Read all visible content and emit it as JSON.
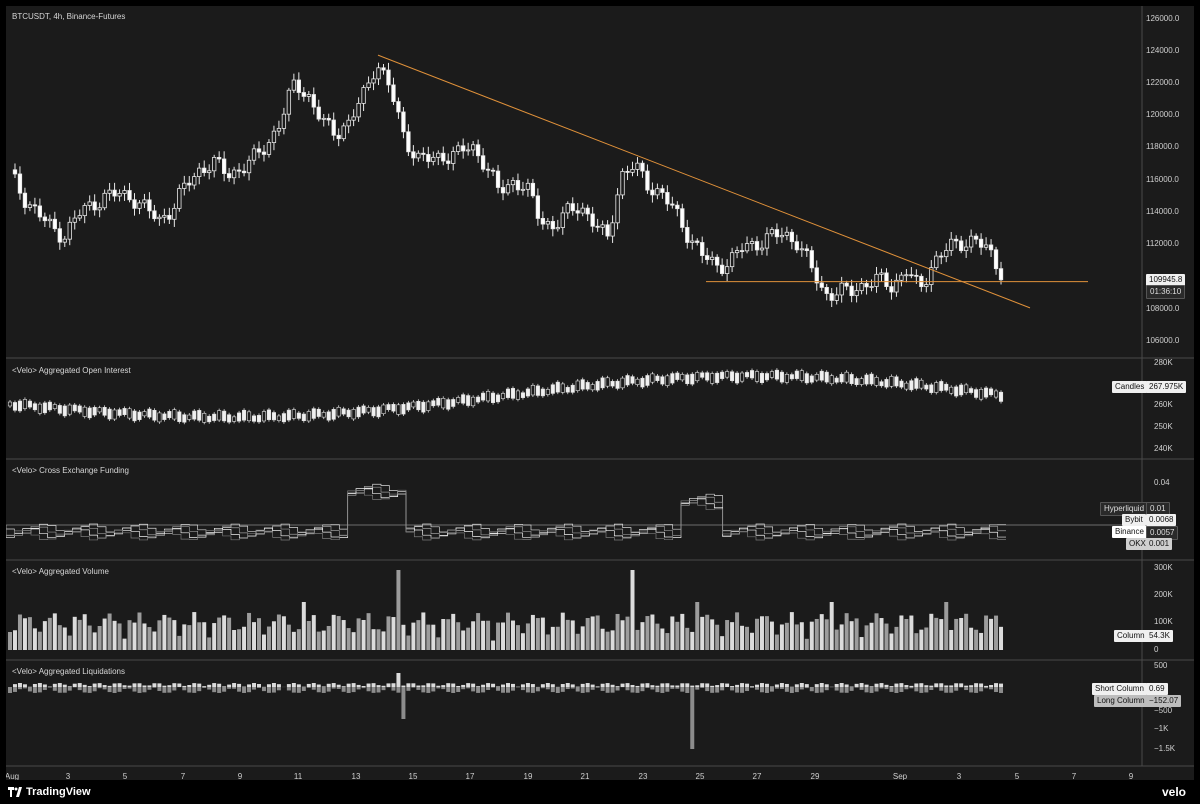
{
  "symbol_title": "BTCUSDT, 4h, Binance-Futures",
  "panes": {
    "open_interest": {
      "title": "<Velo> Aggregated Open Interest",
      "axis": [
        "280K",
        "260K",
        "250K",
        "240K"
      ],
      "tag_label": "Candles",
      "tag_value": "267.975K"
    },
    "funding": {
      "title": "<Velo> Cross Exchange Funding",
      "axis": [
        "0.04"
      ],
      "tags": [
        {
          "label": "Hyperliquid",
          "value": "0.01"
        },
        {
          "label": "Bybit",
          "value": "0.0068"
        },
        {
          "label": "Binance",
          "value": "0.0057"
        },
        {
          "label": "OKX",
          "value": "0.001"
        }
      ]
    },
    "volume": {
      "title": "<Velo> Aggregated Volume",
      "axis": [
        "300K",
        "200K",
        "100K",
        "0"
      ],
      "tag_label": "Column",
      "tag_value": "54.3K"
    },
    "liquidations": {
      "title": "<Velo> Aggregated Liquidations",
      "axis": [
        "500",
        "0",
        "−500",
        "−1K",
        "−1.5K"
      ],
      "short_label": "Short Column",
      "short_value": "0.69",
      "long_label": "Long Column",
      "long_value": "−152.07"
    }
  },
  "price_axis": [
    "126000.0",
    "124000.0",
    "122000.0",
    "120000.0",
    "118000.0",
    "116000.0",
    "114000.0",
    "112000.0",
    "108000.0",
    "106000.0"
  ],
  "last_price": "109945.8",
  "countdown": "01:36:10",
  "date_axis": [
    "Aug",
    "3",
    "5",
    "7",
    "9",
    "11",
    "13",
    "15",
    "17",
    "19",
    "21",
    "23",
    "25",
    "27",
    "29",
    "Sep",
    "3",
    "5",
    "7",
    "9"
  ],
  "footer": {
    "brand": "TradingView",
    "velo": "velo"
  },
  "colors": {
    "background": "#1b1b1b",
    "trendline": "#e0913a",
    "support": "#e0913a",
    "candle_up": "#1b1b1b",
    "candle_down": "#ffffff"
  },
  "chart_data": {
    "type": "candlestick",
    "title": "BTCUSDT, 4h, Binance-Futures",
    "ylim": [
      105000,
      127000
    ],
    "closes_approx": [
      116500,
      115000,
      114000,
      113000,
      112500,
      113800,
      114500,
      115000,
      115200,
      115000,
      114200,
      113500,
      114300,
      115800,
      116800,
      117200,
      116500,
      116800,
      117500,
      118500,
      120000,
      122500,
      121500,
      119800,
      119200,
      119800,
      121500,
      123800,
      122000,
      119000,
      117500,
      117400,
      117700,
      117800,
      118300,
      117200,
      115300,
      116000,
      115700,
      113600,
      113100,
      113900,
      114500,
      113300,
      112200,
      116400,
      117000,
      115800,
      115200,
      114000,
      112500,
      111200,
      110500,
      110800,
      111700,
      112000,
      112400,
      112600,
      112100,
      110400,
      108700,
      108800,
      108900,
      109400,
      109600,
      109200,
      110300,
      108900,
      110800,
      111600,
      112000,
      112300,
      111500,
      110200
    ],
    "trendline": {
      "from": 124200,
      "to": 107800
    },
    "support_level": 109500
  }
}
